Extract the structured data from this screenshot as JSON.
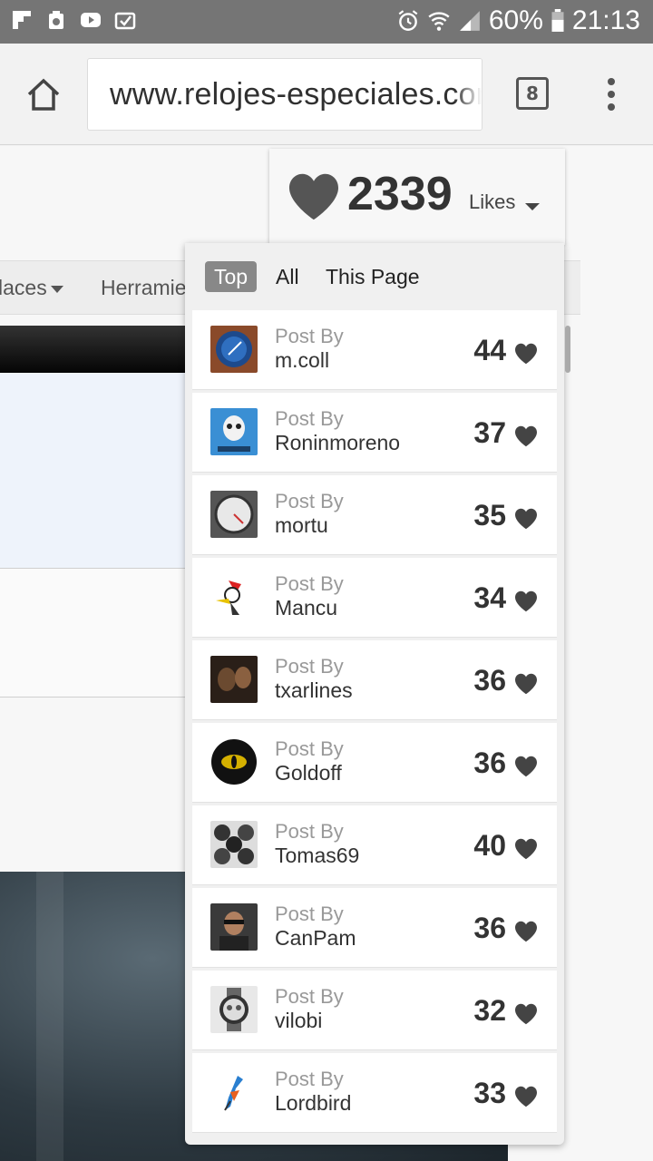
{
  "status_bar": {
    "battery": "60%",
    "time": "21:13"
  },
  "browser": {
    "url": "www.relojes-especiales.com",
    "tab_count": "8"
  },
  "page_nav": {
    "item1": "laces",
    "item2": "Herramie"
  },
  "likes_widget": {
    "total": "2339",
    "label": "Likes",
    "tabs": [
      {
        "label": "Top",
        "active": true
      },
      {
        "label": "All",
        "active": false
      },
      {
        "label": "This Page",
        "active": false
      }
    ],
    "post_by_label": "Post By",
    "entries": [
      {
        "user": "m.coll",
        "count": "44",
        "avatar": "watch-blue-icon"
      },
      {
        "user": "Roninmoreno",
        "count": "37",
        "avatar": "punisher-skull-icon"
      },
      {
        "user": "mortu",
        "count": "35",
        "avatar": "gauge-dial-icon"
      },
      {
        "user": "Mancu",
        "count": "34",
        "avatar": "woodpecker-icon"
      },
      {
        "user": "txarlines",
        "count": "36",
        "avatar": "dark-faces-icon"
      },
      {
        "user": "Goldoff",
        "count": "36",
        "avatar": "yellow-eye-icon"
      },
      {
        "user": "Tomas69",
        "count": "40",
        "avatar": "watch-grid-icon"
      },
      {
        "user": "CanPam",
        "count": "36",
        "avatar": "man-portrait-icon"
      },
      {
        "user": "vilobi",
        "count": "32",
        "avatar": "chronograph-icon"
      },
      {
        "user": "Lordbird",
        "count": "33",
        "avatar": "bird-icon"
      }
    ]
  },
  "colors": {
    "status_bar": "#757575",
    "heart": "#555555",
    "active_tab": "#888888"
  }
}
